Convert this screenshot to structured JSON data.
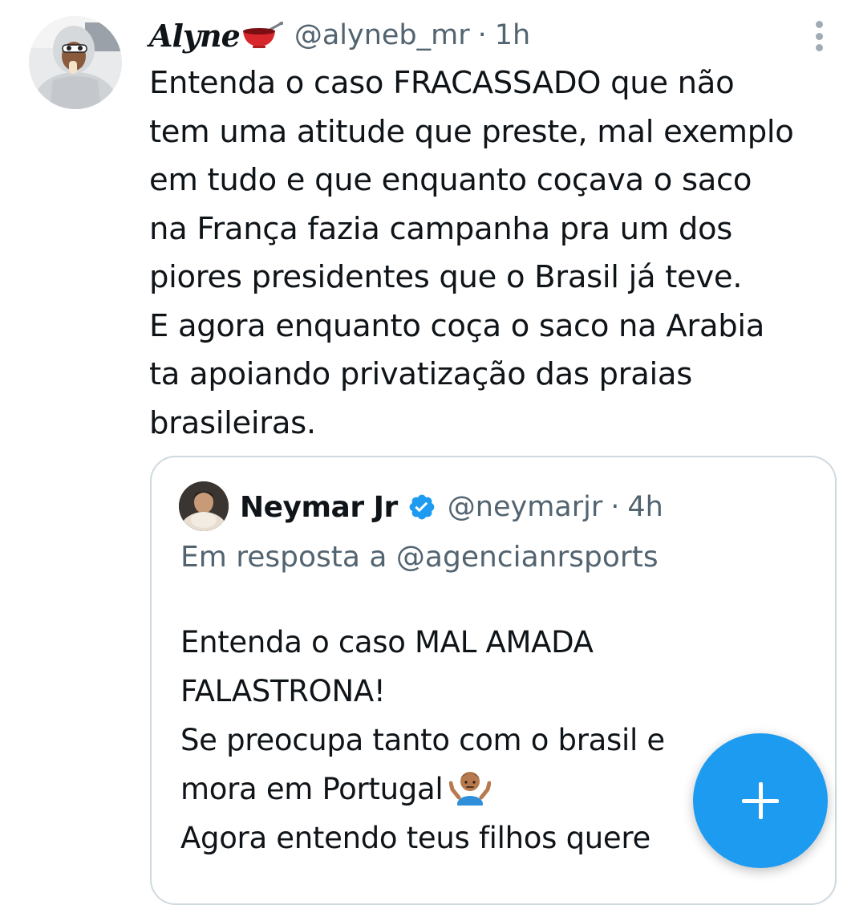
{
  "tweet": {
    "author": {
      "display_name": "Alyne",
      "name_emoji_icon": "red-bowl-icon",
      "handle": "@alyneb_mr",
      "separator": "·",
      "time": "1h"
    },
    "more_icon": "vertical-dots-icon",
    "text_lines": [
      "Entenda o caso FRACASSADO que não",
      "tem uma atitude que preste, mal exemplo",
      "em tudo e que enquanto coçava o saco",
      "na França fazia campanha pra um dos",
      "piores presidentes que o Brasil já teve.",
      "E agora enquanto coça o saco na Arabia",
      "ta apoiando privatização das praias",
      "brasileiras."
    ]
  },
  "quoted_tweet": {
    "author": {
      "display_name": "Neymar Jr",
      "verified_icon": "verified-badge-icon",
      "handle": "@neymarjr",
      "separator": "·",
      "time": "4h"
    },
    "reply_to": "Em resposta a @agencianrsports",
    "text_lines": [
      "Entenda o caso MAL AMADA",
      "FALASTRONA!",
      "Se preocupa tanto com o brasil e",
      "mora em Portugal",
      "Agora entendo teus filhos quere"
    ],
    "inline_emoji": "person-shrugging-icon"
  },
  "compose_button": {
    "icon": "plus-icon"
  },
  "colors": {
    "text_primary": "#0f1419",
    "text_secondary": "#536471",
    "border": "#cfd9de",
    "accent_blue": "#1d9bf0"
  }
}
